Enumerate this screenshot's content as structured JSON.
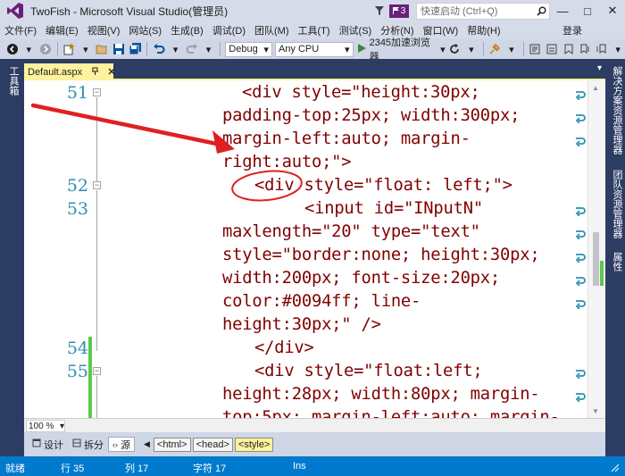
{
  "title_bar": {
    "title": "TwoFish - Microsoft Visual Studio(管理员)",
    "notification_count": "3",
    "quick_launch_placeholder": "快速启动 (Ctrl+Q)",
    "minimize": "—",
    "maximize": "□",
    "close": "✕"
  },
  "menu": {
    "items": [
      "文件(F)",
      "编辑(E)",
      "视图(V)",
      "网站(S)",
      "生成(B)",
      "调试(D)",
      "团队(M)",
      "工具(T)",
      "测试(S)",
      "分析(N)",
      "窗口(W)",
      "帮助(H)"
    ],
    "login": "登录"
  },
  "toolbar": {
    "configuration": "Debug",
    "platform": "Any CPU",
    "run_target": "2345加速浏览器"
  },
  "left_strip": {
    "label": "工具箱"
  },
  "right_strip": {
    "labels": [
      "解决方案资源管理器",
      "团队资源管理器",
      "属性"
    ]
  },
  "document_tab": {
    "label": "Default.aspx"
  },
  "editor": {
    "line_numbers": [
      "51",
      "52",
      "53",
      "54",
      "55"
    ],
    "code_lines": [
      "<div style=\"height:30px;",
      "padding-top:25px; width:300px;",
      "margin-left:auto; margin-",
      "right:auto;\">",
      "<div style=\"float: left;\">",
      "<input id=\"INputN\"",
      "maxlength=\"20\" type=\"text\"",
      "style=\"border:none; height:30px;",
      "width:200px; font-size:20px;",
      "color:#0094ff; line-",
      "height:30px;\" />",
      "</div>",
      "<div style=\"float:left;",
      "height:28px; width:80px; margin-",
      "top:5px; margin-left:auto; margin-"
    ]
  },
  "zoom": {
    "level": "100 %"
  },
  "view_bar": {
    "design": "设计",
    "split": "拆分",
    "source": "源",
    "breadcrumbs": [
      "<html>",
      "<head>",
      "<style>"
    ]
  },
  "status_bar": {
    "state": "就绪",
    "line": "行 35",
    "column": "列 17",
    "char": "字符 17",
    "mode": "Ins"
  },
  "colors": {
    "title_bar_bg": "#d6dbe9",
    "strip_bg": "#2d3c63",
    "tab_active": "#fff29d",
    "status_bar": "#007acc",
    "line_number": "#2b91af",
    "code_text": "#800000",
    "change_marker": "#5cc94b",
    "annotation": "#e02020"
  }
}
